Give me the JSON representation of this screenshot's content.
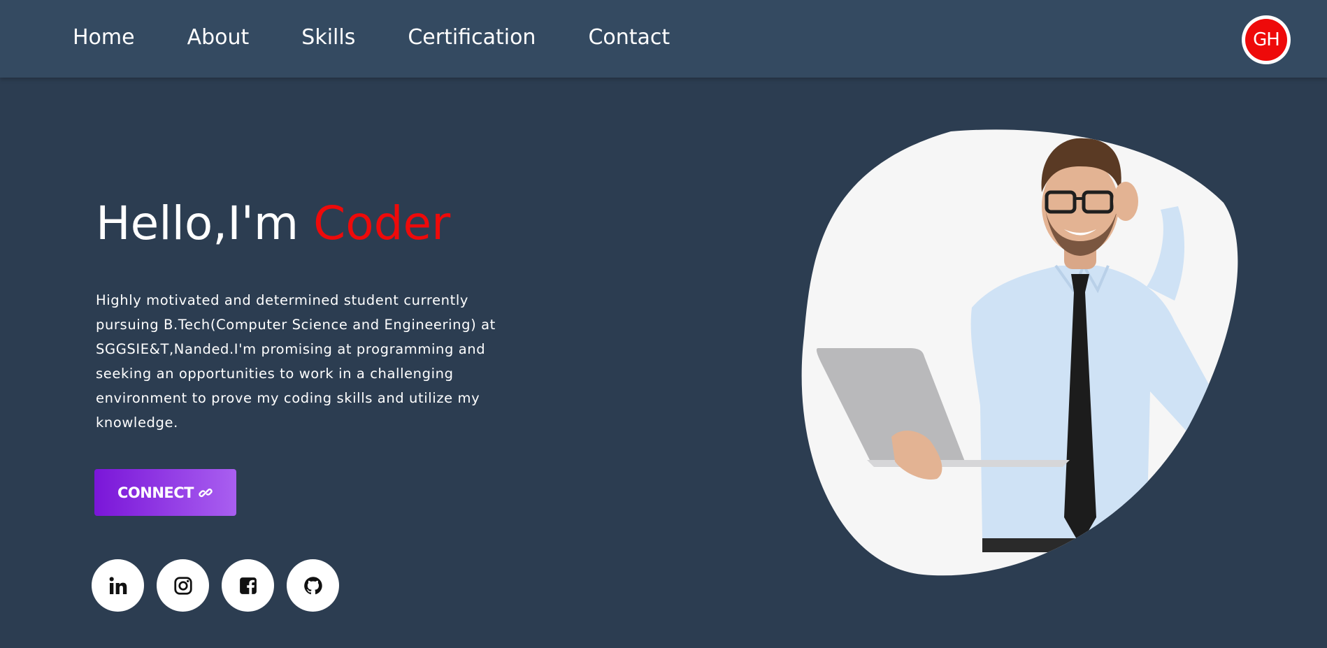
{
  "nav": {
    "items": [
      {
        "label": "Home"
      },
      {
        "label": "About"
      },
      {
        "label": "Skills"
      },
      {
        "label": "Certification"
      },
      {
        "label": "Contact"
      }
    ],
    "logo_text": "GH"
  },
  "hero": {
    "greeting": "Hello,I'm",
    "highlight": "Coder",
    "description": "Highly motivated and determined student currently pursuing B.Tech(Computer Science and Engineering) at SGGSIE&T,Nanded.I'm promising at programming and seeking an opportunities to work in a challenging environment to prove my coding skills and utilize my knowledge.",
    "connect_label": "CONNECT"
  },
  "social": [
    {
      "icon": "linkedin-icon"
    },
    {
      "icon": "instagram-icon"
    },
    {
      "icon": "facebook-icon"
    },
    {
      "icon": "github-icon"
    }
  ],
  "colors": {
    "background": "#2c3d51",
    "navbar": "#344a61",
    "accent_red": "#ee0a0a",
    "button_gradient_start": "#7a16d8",
    "button_gradient_end": "#a95ff0"
  }
}
